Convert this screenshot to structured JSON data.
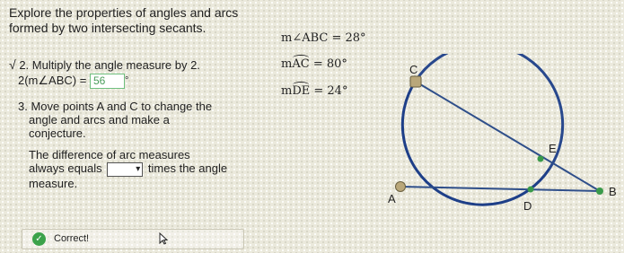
{
  "intro": {
    "line1": "Explore the properties of angles and arcs",
    "line2": "formed by two intersecting secants."
  },
  "measures": {
    "angle_label": "m∠ABC = 28°",
    "arc_prefix": "m",
    "arc_ac_letters": "AC",
    "arc_ac_value": "= 80°",
    "arc_de_letters": "DE",
    "arc_de_value": "= 24°"
  },
  "step2": {
    "check": "√",
    "text": "2. Multiply the angle measure by 2.",
    "expr": "2(m∠ABC) =",
    "answer": "56",
    "degree": "°"
  },
  "step3": {
    "line1": "3. Move points A and C to change the",
    "line2": "angle and arcs and make a",
    "line3": "conjecture.",
    "line4": "The difference of arc measures",
    "line5_pre": "always equals",
    "line5_post": "times the angle",
    "line6": "measure."
  },
  "feedback": {
    "text": "Correct!"
  },
  "diagram": {
    "points": {
      "A": "A",
      "B": "B",
      "C": "C",
      "D": "D",
      "E": "E"
    },
    "colors": {
      "circle": "#1e3f88",
      "line": "#2f4f8a",
      "point_green": "#3a9a4a",
      "point_tan": "#b9a77a"
    }
  }
}
